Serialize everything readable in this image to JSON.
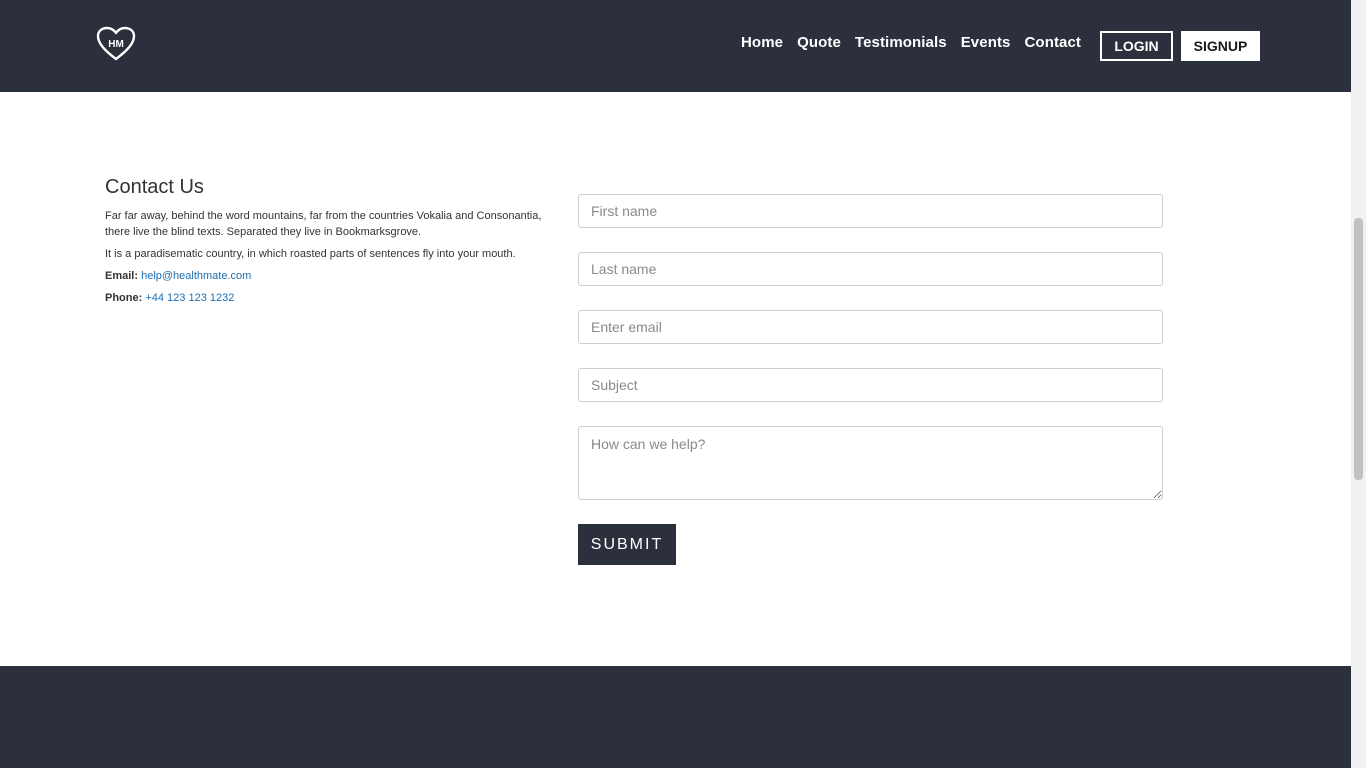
{
  "navbar": {
    "logo_alt": "HM",
    "links": [
      "Home",
      "Quote",
      "Testimonials",
      "Events",
      "Contact"
    ],
    "login_label": "LOGIN",
    "signup_label": "SIGNUP",
    "background_color": "#2c2f3c"
  },
  "contact": {
    "title": "Contact Us",
    "paragraph1": "Far far away, behind the word mountains, far from the countries Vokalia and Consonantia, there live the blind texts. Separated they live in Bookmarksgrove.",
    "paragraph2": "It is a paradisematic country, in which roasted parts of sentences fly into your mouth.",
    "email_label": "Email:",
    "email_value": "help@healthmate.com",
    "phone_label": "Phone:",
    "phone_value": "+44 123 123 1232"
  },
  "form": {
    "first_name_placeholder": "First name",
    "last_name_placeholder": "Last name",
    "email_placeholder": "Enter email",
    "subject_placeholder": "Subject",
    "message_placeholder": "How can we help?",
    "submit_label": "SUBMIT"
  }
}
